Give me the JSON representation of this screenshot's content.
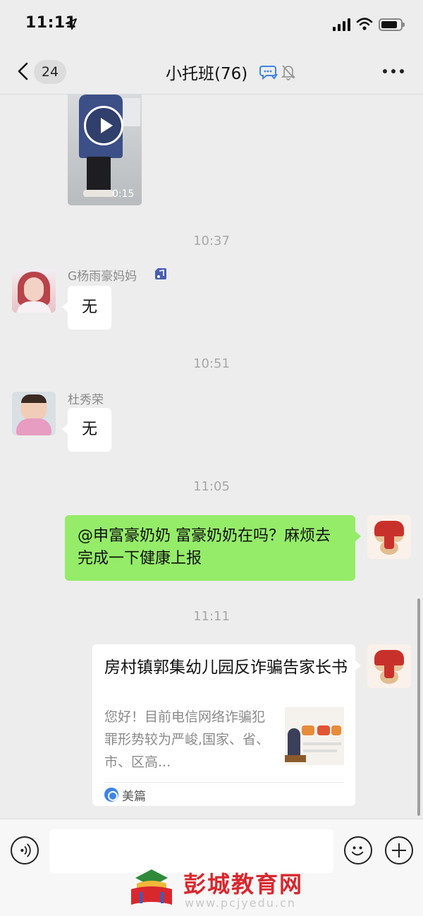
{
  "status_bar": {
    "time": "11:11"
  },
  "nav": {
    "back_count": "24",
    "title": "小托班(76)"
  },
  "messages": {
    "video": {
      "duration": "0:15"
    },
    "time_1": "10:37",
    "msg_yang": {
      "sender": "G杨雨豪妈妈",
      "text": "无"
    },
    "time_2": "10:51",
    "msg_du": {
      "sender": "杜秀荣",
      "text": "无"
    },
    "time_3": "11:05",
    "msg_out": {
      "text": "@申富豪奶奶 富豪奶奶在吗？麻烦去完成一下健康上报"
    },
    "time_4": "11:11",
    "link_card": {
      "title": "房村镇郭集幼儿园反诈骗告家长书",
      "description": "您好！目前电信网络诈骗犯罪形势较为严峻,国家、省、市、区高...",
      "source": "美篇"
    }
  },
  "input_bar": {
    "value": ""
  },
  "watermark": {
    "text": "彭城教育网",
    "url": "www.pcjyedu.cn"
  },
  "colors": {
    "background": "#ededed",
    "outgoing_bubble": "#95ec69",
    "incoming_bubble": "#ffffff",
    "watermark_red": "#d9272e",
    "meipian_blue": "#3f84e5"
  },
  "icons": [
    "location-arrow-icon",
    "signal-icon",
    "wifi-icon",
    "battery-icon",
    "back-chevron-icon",
    "chat-bubble-icon",
    "mute-bell-icon",
    "more-icon",
    "play-icon",
    "badge-icon",
    "meipian-icon",
    "voice-icon",
    "emoji-icon",
    "plus-icon"
  ]
}
